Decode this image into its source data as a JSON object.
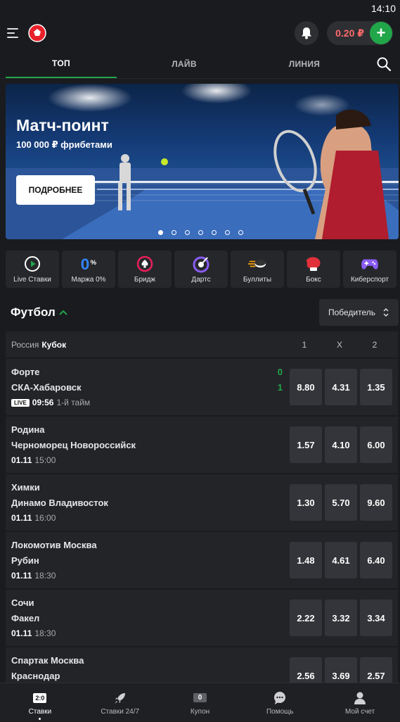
{
  "status": {
    "time": "14:10"
  },
  "header": {
    "balance": "0.20 ₽",
    "plus": "+"
  },
  "tabs": [
    {
      "label": "ТОП"
    },
    {
      "label": "ЛАЙВ"
    },
    {
      "label": "ЛИНИЯ"
    }
  ],
  "banner": {
    "title": "Матч-поинт",
    "subtitle": "100 000 ₽ фрибетами",
    "button": "ПОДРОБНЕЕ",
    "slides": 7,
    "active_slide": 1
  },
  "sports": [
    {
      "label": "Live Ставки",
      "icon": "play-circle-icon"
    },
    {
      "label": "Маржа 0%",
      "icon": "zero-percent-icon"
    },
    {
      "label": "Бридж",
      "icon": "spade-icon"
    },
    {
      "label": "Дартс",
      "icon": "dart-target-icon"
    },
    {
      "label": "Буллиты",
      "icon": "hockey-puck-icon"
    },
    {
      "label": "Бокс",
      "icon": "boxing-glove-icon"
    },
    {
      "label": "Киберспорт",
      "icon": "gamepad-icon"
    }
  ],
  "section": {
    "title": "Футбол",
    "dropdown": "Победитель"
  },
  "league": {
    "country": "Россия",
    "name": "Кубок",
    "cols": [
      "1",
      "X",
      "2"
    ]
  },
  "matches": [
    {
      "team1": "Форте",
      "team2": "СКА-Хабаровск",
      "live": true,
      "live_label": "LIVE",
      "date": "09:56",
      "time": "1-й тайм",
      "score1": "0",
      "score2": "1",
      "odds": [
        "8.80",
        "4.31",
        "1.35"
      ]
    },
    {
      "team1": "Родина",
      "team2": "Черноморец Новороссийск",
      "live": false,
      "date": "01.11",
      "time": "15:00",
      "odds": [
        "1.57",
        "4.10",
        "6.00"
      ]
    },
    {
      "team1": "Химки",
      "team2": "Динамо Владивосток",
      "live": false,
      "date": "01.11",
      "time": "16:00",
      "odds": [
        "1.30",
        "5.70",
        "9.60"
      ]
    },
    {
      "team1": "Локомотив Москва",
      "team2": "Рубин",
      "live": false,
      "date": "01.11",
      "time": "18:30",
      "odds": [
        "1.48",
        "4.61",
        "6.40"
      ]
    },
    {
      "team1": "Сочи",
      "team2": "Факел",
      "live": false,
      "date": "01.11",
      "time": "18:30",
      "odds": [
        "2.22",
        "3.32",
        "3.34"
      ]
    },
    {
      "team1": "Спартак Москва",
      "team2": "Краснодар",
      "live": false,
      "date": "",
      "time": "",
      "odds": [
        "2.56",
        "3.69",
        "2.57"
      ]
    }
  ],
  "bottom_nav": [
    {
      "label": "Ставки",
      "chip": "2:0",
      "active": true
    },
    {
      "label": "Ставки 24/7",
      "icon": "rocket-icon"
    },
    {
      "label": "Купон",
      "chip": "0"
    },
    {
      "label": "Помощь",
      "icon": "chat-icon"
    },
    {
      "label": "Мой счет",
      "icon": "user-icon"
    }
  ],
  "colors": {
    "accent": "#21a649",
    "balance": "#ff6b6b",
    "background": "#1a1b1e"
  }
}
